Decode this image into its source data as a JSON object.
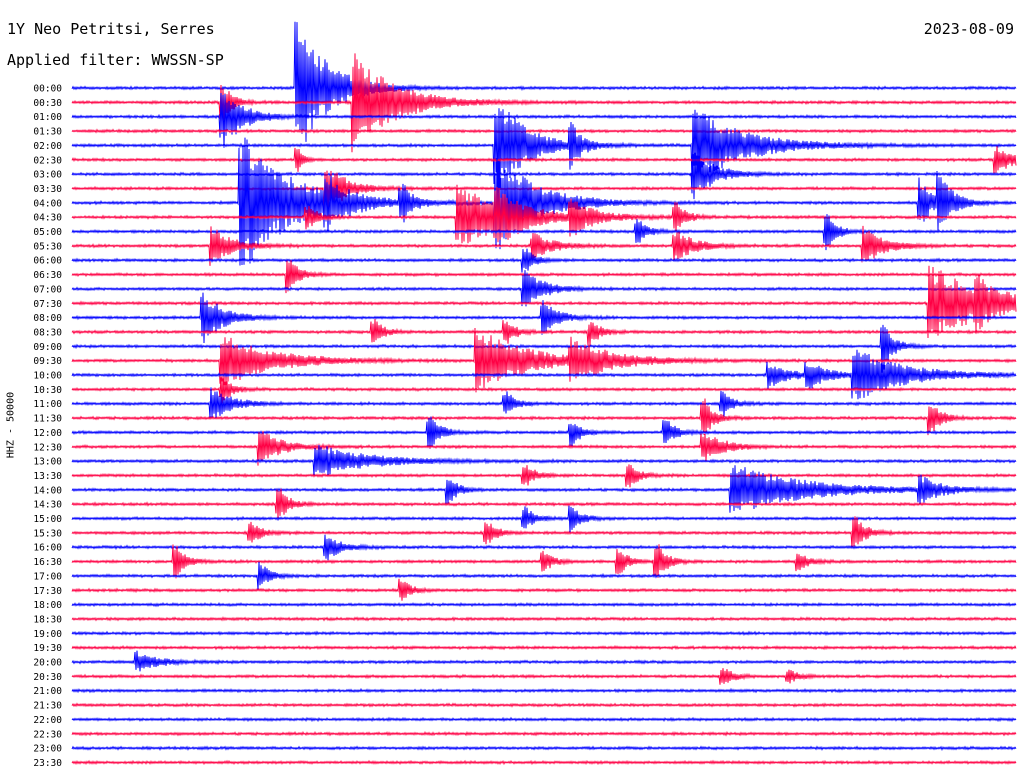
{
  "header": {
    "station": "1Y Neo Petritsi, Serres",
    "date": "2023-08-09",
    "filter": "Applied filter: WWSSN-SP"
  },
  "chart_data": {
    "type": "helicorder",
    "title": "1Y Neo Petritsi, Serres",
    "date": "2023-08-09",
    "ylabel": "HHZ - 50000",
    "row_labels": [
      "00:00",
      "00:30",
      "01:00",
      "01:30",
      "02:00",
      "02:30",
      "03:00",
      "03:30",
      "04:00",
      "04:30",
      "05:00",
      "05:30",
      "06:00",
      "06:30",
      "07:00",
      "07:30",
      "08:00",
      "08:30",
      "09:00",
      "09:30",
      "10:00",
      "10:30",
      "11:00",
      "11:30",
      "12:00",
      "12:30",
      "13:00",
      "13:30",
      "14:00",
      "14:30",
      "15:00",
      "15:30",
      "16:00",
      "16:30",
      "17:00",
      "17:30",
      "18:00",
      "18:30",
      "19:00",
      "19:30",
      "20:00",
      "20:30",
      "21:00",
      "21:30",
      "22:00",
      "22:30",
      "23:00",
      "23:30"
    ],
    "colors": {
      "even_rows": "#0000ff",
      "odd_rows": "#ff0044"
    },
    "events": [
      {
        "row": 0,
        "t": 0.24,
        "amp": 5.5,
        "dur": 0.03
      },
      {
        "row": 1,
        "t": 0.3,
        "amp": 4,
        "dur": 0.04
      },
      {
        "row": 1,
        "t": 0.16,
        "amp": 1.5,
        "dur": 0.01
      },
      {
        "row": 2,
        "t": 0.16,
        "amp": 2.5,
        "dur": 0.02
      },
      {
        "row": 4,
        "t": 0.45,
        "amp": 4,
        "dur": 0.03
      },
      {
        "row": 4,
        "t": 0.66,
        "amp": 3,
        "dur": 0.05
      },
      {
        "row": 4,
        "t": 0.53,
        "amp": 1.5,
        "dur": 0.01
      },
      {
        "row": 5,
        "t": 0.24,
        "amp": 1,
        "dur": 0.005
      },
      {
        "row": 5,
        "t": 0.98,
        "amp": 1,
        "dur": 0.02
      },
      {
        "row": 6,
        "t": 0.66,
        "amp": 2,
        "dur": 0.02
      },
      {
        "row": 7,
        "t": 0.27,
        "amp": 2,
        "dur": 0.02
      },
      {
        "row": 8,
        "t": 0.18,
        "amp": 5.5,
        "dur": 0.05
      },
      {
        "row": 8,
        "t": 0.45,
        "amp": 4,
        "dur": 0.04
      },
      {
        "row": 8,
        "t": 0.35,
        "amp": 1.5,
        "dur": 0.01
      },
      {
        "row": 8,
        "t": 0.27,
        "amp": 1.5,
        "dur": 0.02
      },
      {
        "row": 8,
        "t": 0.9,
        "amp": 2,
        "dur": 0.01
      },
      {
        "row": 8,
        "t": 0.92,
        "amp": 2,
        "dur": 0.015
      },
      {
        "row": 9,
        "t": 0.41,
        "amp": 2.5,
        "dur": 0.05
      },
      {
        "row": 9,
        "t": 0.45,
        "amp": 1.5,
        "dur": 0.02
      },
      {
        "row": 9,
        "t": 0.53,
        "amp": 1.3,
        "dur": 0.02
      },
      {
        "row": 9,
        "t": 0.25,
        "amp": 1,
        "dur": 0.01
      },
      {
        "row": 9,
        "t": 0.64,
        "amp": 1.2,
        "dur": 0.01
      },
      {
        "row": 10,
        "t": 0.6,
        "amp": 1,
        "dur": 0.01
      },
      {
        "row": 10,
        "t": 0.8,
        "amp": 1.5,
        "dur": 0.01
      },
      {
        "row": 11,
        "t": 0.15,
        "amp": 1.5,
        "dur": 0.02
      },
      {
        "row": 11,
        "t": 0.49,
        "amp": 1,
        "dur": 0.02
      },
      {
        "row": 11,
        "t": 0.64,
        "amp": 1.2,
        "dur": 0.02
      },
      {
        "row": 11,
        "t": 0.84,
        "amp": 1.5,
        "dur": 0.02
      },
      {
        "row": 12,
        "t": 0.48,
        "amp": 1,
        "dur": 0.01
      },
      {
        "row": 13,
        "t": 0.23,
        "amp": 1.5,
        "dur": 0.01
      },
      {
        "row": 14,
        "t": 0.48,
        "amp": 1.5,
        "dur": 0.02
      },
      {
        "row": 15,
        "t": 0.91,
        "amp": 3,
        "dur": 0.06
      },
      {
        "row": 15,
        "t": 0.96,
        "amp": 1,
        "dur": 0.01
      },
      {
        "row": 16,
        "t": 0.14,
        "amp": 2,
        "dur": 0.02
      },
      {
        "row": 16,
        "t": 0.5,
        "amp": 1.3,
        "dur": 0.015
      },
      {
        "row": 17,
        "t": 0.32,
        "amp": 1,
        "dur": 0.01
      },
      {
        "row": 17,
        "t": 0.46,
        "amp": 1,
        "dur": 0.01
      },
      {
        "row": 17,
        "t": 0.55,
        "amp": 1,
        "dur": 0.01
      },
      {
        "row": 18,
        "t": 0.86,
        "amp": 2,
        "dur": 0.01
      },
      {
        "row": 19,
        "t": 0.16,
        "amp": 2,
        "dur": 0.05
      },
      {
        "row": 19,
        "t": 0.43,
        "amp": 2.5,
        "dur": 0.05
      },
      {
        "row": 19,
        "t": 0.53,
        "amp": 1.5,
        "dur": 0.04
      },
      {
        "row": 20,
        "t": 0.83,
        "amp": 2,
        "dur": 0.05
      },
      {
        "row": 20,
        "t": 0.74,
        "amp": 1,
        "dur": 0.02
      },
      {
        "row": 20,
        "t": 0.78,
        "amp": 1,
        "dur": 0.02
      },
      {
        "row": 21,
        "t": 0.16,
        "amp": 1,
        "dur": 0.01
      },
      {
        "row": 22,
        "t": 0.15,
        "amp": 1.2,
        "dur": 0.02
      },
      {
        "row": 22,
        "t": 0.46,
        "amp": 1,
        "dur": 0.01
      },
      {
        "row": 22,
        "t": 0.69,
        "amp": 1,
        "dur": 0.01
      },
      {
        "row": 23,
        "t": 0.67,
        "amp": 1.5,
        "dur": 0.01
      },
      {
        "row": 23,
        "t": 0.91,
        "amp": 1.5,
        "dur": 0.01
      },
      {
        "row": 24,
        "t": 0.38,
        "amp": 1.5,
        "dur": 0.01
      },
      {
        "row": 24,
        "t": 0.53,
        "amp": 1,
        "dur": 0.01
      },
      {
        "row": 24,
        "t": 0.63,
        "amp": 1,
        "dur": 0.01
      },
      {
        "row": 25,
        "t": 0.2,
        "amp": 1.5,
        "dur": 0.02
      },
      {
        "row": 25,
        "t": 0.67,
        "amp": 1.2,
        "dur": 0.02
      },
      {
        "row": 26,
        "t": 0.26,
        "amp": 1.3,
        "dur": 0.05
      },
      {
        "row": 27,
        "t": 0.48,
        "amp": 1,
        "dur": 0.01
      },
      {
        "row": 27,
        "t": 0.59,
        "amp": 1,
        "dur": 0.01
      },
      {
        "row": 28,
        "t": 0.4,
        "amp": 1,
        "dur": 0.01
      },
      {
        "row": 28,
        "t": 0.7,
        "amp": 2,
        "dur": 0.07
      },
      {
        "row": 28,
        "t": 0.9,
        "amp": 1,
        "dur": 0.02
      },
      {
        "row": 29,
        "t": 0.22,
        "amp": 1.3,
        "dur": 0.01
      },
      {
        "row": 30,
        "t": 0.48,
        "amp": 1,
        "dur": 0.01
      },
      {
        "row": 30,
        "t": 0.53,
        "amp": 1,
        "dur": 0.01
      },
      {
        "row": 31,
        "t": 0.19,
        "amp": 1,
        "dur": 0.01
      },
      {
        "row": 31,
        "t": 0.44,
        "amp": 1,
        "dur": 0.01
      },
      {
        "row": 31,
        "t": 0.83,
        "amp": 1.5,
        "dur": 0.01
      },
      {
        "row": 32,
        "t": 0.27,
        "amp": 1,
        "dur": 0.015
      },
      {
        "row": 33,
        "t": 0.11,
        "amp": 1.3,
        "dur": 0.01
      },
      {
        "row": 33,
        "t": 0.5,
        "amp": 0.8,
        "dur": 0.01
      },
      {
        "row": 33,
        "t": 0.58,
        "amp": 1,
        "dur": 0.01
      },
      {
        "row": 33,
        "t": 0.62,
        "amp": 1.5,
        "dur": 0.01
      },
      {
        "row": 33,
        "t": 0.77,
        "amp": 0.8,
        "dur": 0.01
      },
      {
        "row": 34,
        "t": 0.2,
        "amp": 1,
        "dur": 0.01
      },
      {
        "row": 35,
        "t": 0.35,
        "amp": 0.8,
        "dur": 0.01
      },
      {
        "row": 40,
        "t": 0.07,
        "amp": 0.8,
        "dur": 0.02
      },
      {
        "row": 41,
        "t": 0.69,
        "amp": 0.8,
        "dur": 0.01
      },
      {
        "row": 41,
        "t": 0.76,
        "amp": 0.5,
        "dur": 0.01
      }
    ]
  }
}
